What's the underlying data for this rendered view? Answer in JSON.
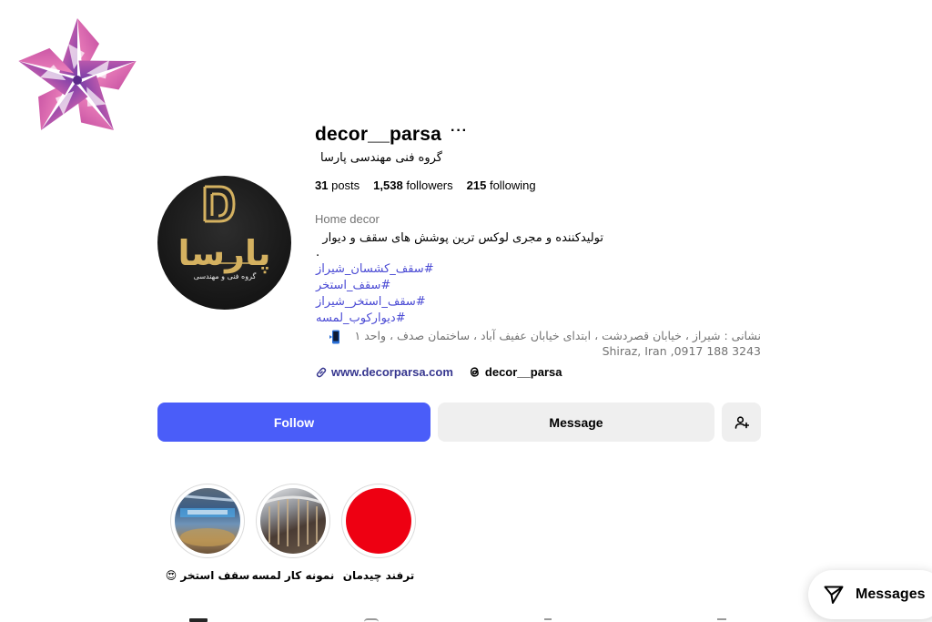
{
  "profile": {
    "username": "decor__parsa",
    "more_glyph": "···",
    "full_name": "گروه فنی مهندسی پارسا",
    "stats": {
      "posts_count": "31",
      "posts_label": "posts",
      "followers_count": "1,538",
      "followers_label": "followers",
      "following_count": "215",
      "following_label": "following"
    },
    "category": "Home decor",
    "bio": {
      "main": "تولیدکننده و مجری لوکس ترین پوشش های سقف و دیوار",
      "dot": ".",
      "hashtags": [
        "#سقف_کشسان_شیراز",
        "#سقف_استخر",
        "#سقف_استخر_شیراز",
        "#دیوارکوب_لمسه"
      ],
      "address_line1": "نشانی : شیراز ، خیابان قصردشت ، ابتدای خیابان عفیف آباد ، ساختمان صدف ، واحد ۱",
      "address_line2": "Shiraz, Iran ,0917 188 3243"
    },
    "website": "www.decorparsa.com",
    "threads_handle": "decor__parsa"
  },
  "avatar": {
    "brand_text": "پارسا",
    "sub_text": "گروه فنی و مهندسی"
  },
  "buttons": {
    "follow": "Follow",
    "message": "Message"
  },
  "highlights": [
    {
      "label": "ترفند چیدمان",
      "image": "red-circle"
    },
    {
      "label": "نمونه کار لمسه",
      "image": "ceiling-photo"
    },
    {
      "label": "سقف استخر 😍",
      "image": "pool-photo"
    }
  ],
  "messages_bar": {
    "label": "Messages"
  },
  "colors": {
    "follow_button": "#4a5df9",
    "secondary_button": "#efefef",
    "link": "#36368f",
    "hashtag": "#4a4ad4",
    "muted_text": "#737373",
    "avatar_gold": "#d4b160",
    "highlight_red": "#ee0012"
  },
  "icons": {
    "logo": "pentagon-pinwheel-logo",
    "more": "more-horizontal-icon",
    "link": "link-icon",
    "threads": "threads-icon",
    "add_user": "add-user-icon",
    "messages": "paper-plane-icon",
    "phone": "mobile-phone-emoji-icon"
  }
}
